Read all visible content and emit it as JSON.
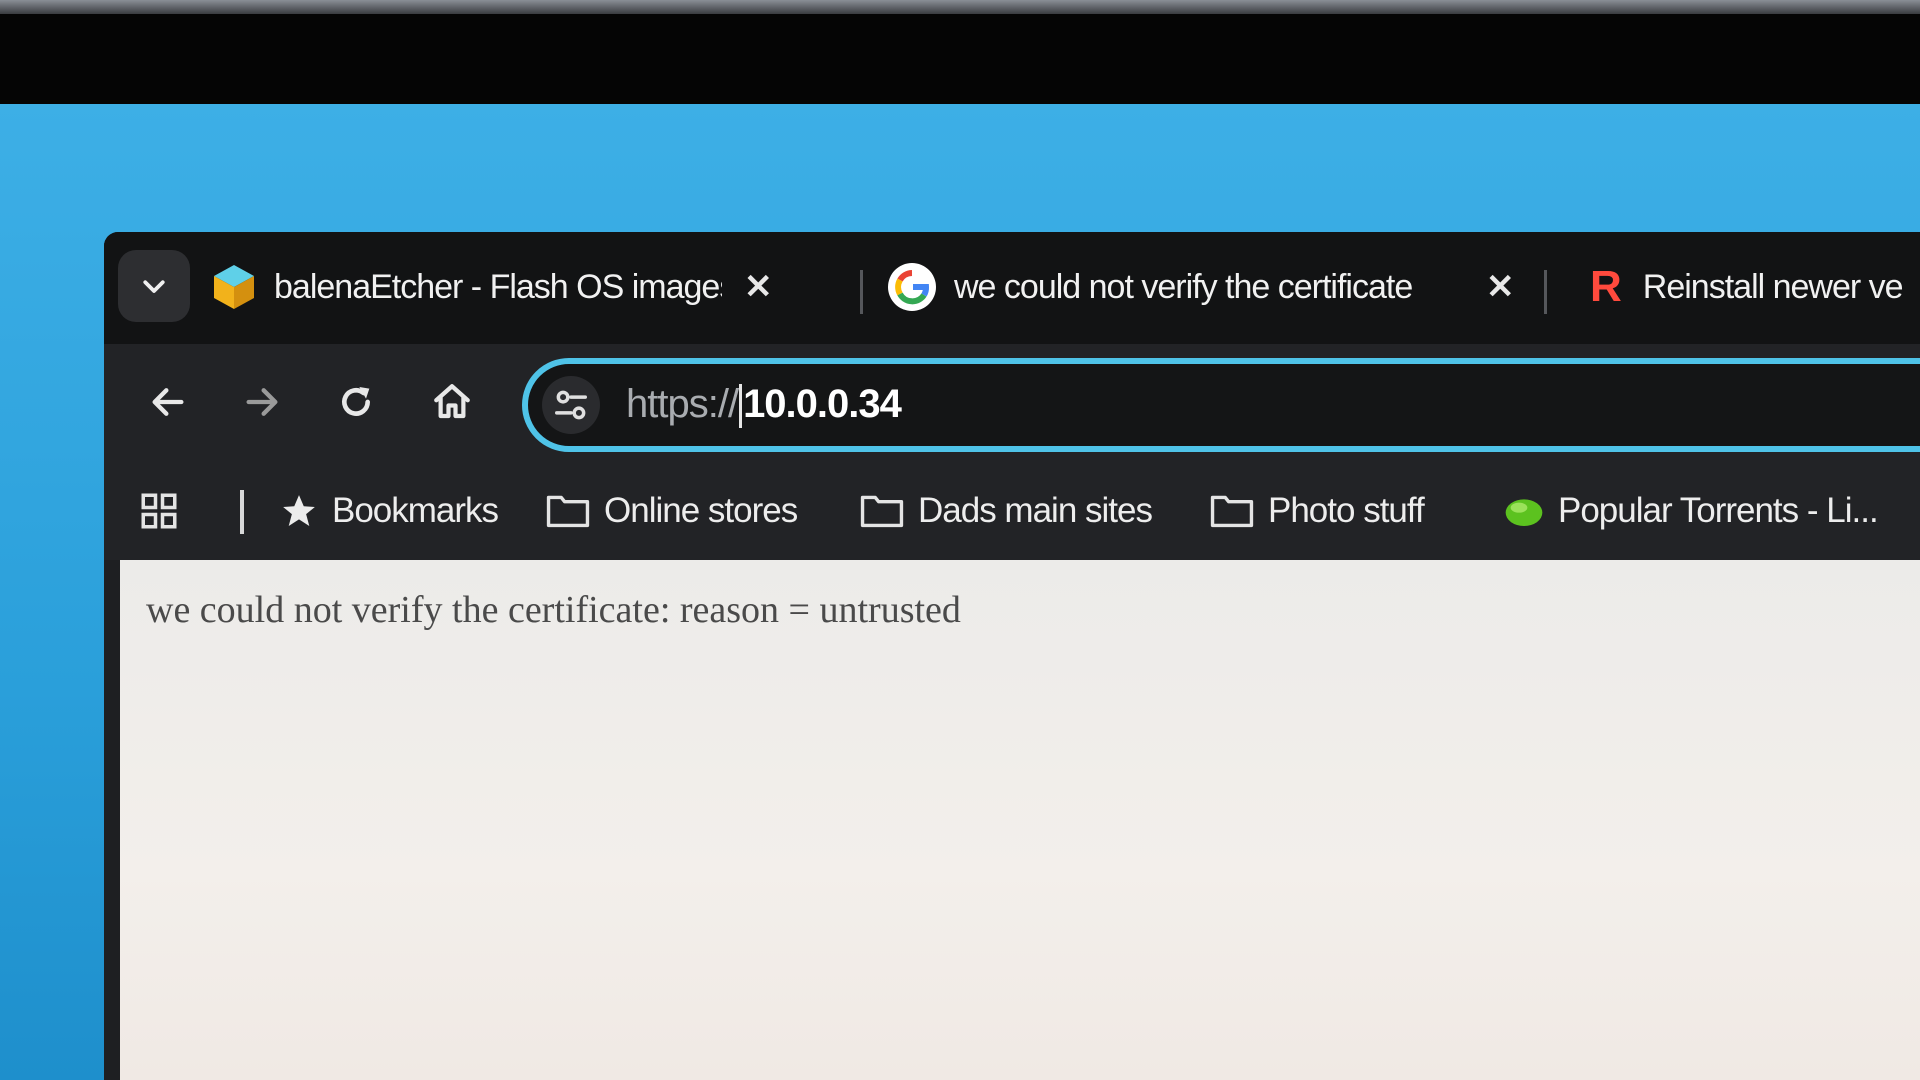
{
  "tabs": [
    {
      "title": "balenaEtcher - Flash OS images",
      "icon": "balena-cube-icon",
      "close": "✕"
    },
    {
      "title": "we could not verify the certificate",
      "icon": "google-g-icon",
      "close": "✕"
    },
    {
      "title": "Reinstall newer ve",
      "icon": "red-r-icon",
      "icon_letter": "R"
    }
  ],
  "address_bar": {
    "scheme": "https://",
    "host": "10.0.0.34"
  },
  "bookmarks": [
    {
      "label": "Bookmarks",
      "icon": "star-icon"
    },
    {
      "label": "Online stores",
      "icon": "folder-icon"
    },
    {
      "label": "Dads main sites",
      "icon": "folder-icon"
    },
    {
      "label": "Photo stuff",
      "icon": "folder-icon"
    },
    {
      "label": "Popular Torrents - Li...",
      "icon": "green-blob-icon"
    }
  ],
  "page": {
    "text": "we could not verify the certificate: reason = untrusted"
  },
  "colors": {
    "desktop_blue": "#2a9fda",
    "omnibox_focus_ring": "#4fc3e8",
    "tab_strip": "#121314",
    "toolbar": "#222326"
  }
}
